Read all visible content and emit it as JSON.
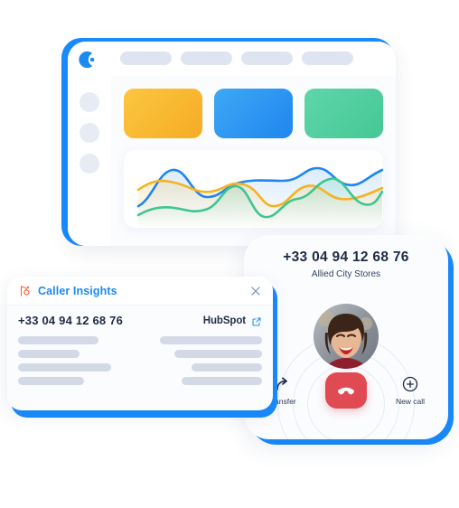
{
  "dashboard": {
    "logo_icon": "aircall-logo-icon",
    "nav_pills": [
      "",
      "",
      "",
      ""
    ],
    "sidebar_dots": [
      "",
      "",
      ""
    ],
    "tiles": [
      {
        "name": "tile-amber",
        "color": "#f5ac23"
      },
      {
        "name": "tile-blue",
        "color": "#1f86ef"
      },
      {
        "name": "tile-green",
        "color": "#45c795"
      }
    ],
    "chart": {
      "series_colors": {
        "blue": "#1f86ef",
        "amber": "#f5b324",
        "green": "#3fc58f"
      }
    }
  },
  "caller_insights": {
    "title": "Caller Insights",
    "title_icon": "hubspot-sprocket-icon",
    "close_icon": "close-icon",
    "phone": "+33 04 94 12 68 76",
    "crm_label": "HubSpot",
    "crm_link_icon": "external-link-icon",
    "skeleton_rows_left": [
      4,
      3,
      4.5,
      3.2
    ],
    "skeleton_rows_right": [
      4.6,
      4.2,
      3.4,
      3.8
    ]
  },
  "call": {
    "number": "+33 04 94 12 68 76",
    "company": "Allied City Stores",
    "avatar_name": "caller-avatar",
    "actions": {
      "transfer": {
        "label": "Transfer",
        "icon": "transfer-arrow-icon"
      },
      "hangup": {
        "label": "",
        "icon": "hangup-phone-icon",
        "color": "#e04a53"
      },
      "new_call": {
        "label": "New call",
        "icon": "plus-circle-icon"
      }
    }
  },
  "chart_data": {
    "type": "line",
    "title": "",
    "xlabel": "",
    "ylabel": "",
    "x": [
      0,
      1,
      2,
      3,
      4,
      5,
      6,
      7,
      8,
      9,
      10
    ],
    "series": [
      {
        "name": "blue",
        "color": "#1f86ef",
        "values": [
          22,
          55,
          62,
          34,
          30,
          48,
          50,
          62,
          58,
          46,
          66
        ]
      },
      {
        "name": "amber",
        "color": "#f5b324",
        "values": [
          42,
          50,
          40,
          34,
          48,
          46,
          20,
          26,
          46,
          40,
          34
        ]
      },
      {
        "name": "green",
        "color": "#3fc58f",
        "values": [
          14,
          22,
          26,
          22,
          46,
          34,
          10,
          28,
          20,
          60,
          28
        ]
      }
    ],
    "grid": false,
    "legend": "none",
    "ylim": [
      0,
      80
    ]
  }
}
